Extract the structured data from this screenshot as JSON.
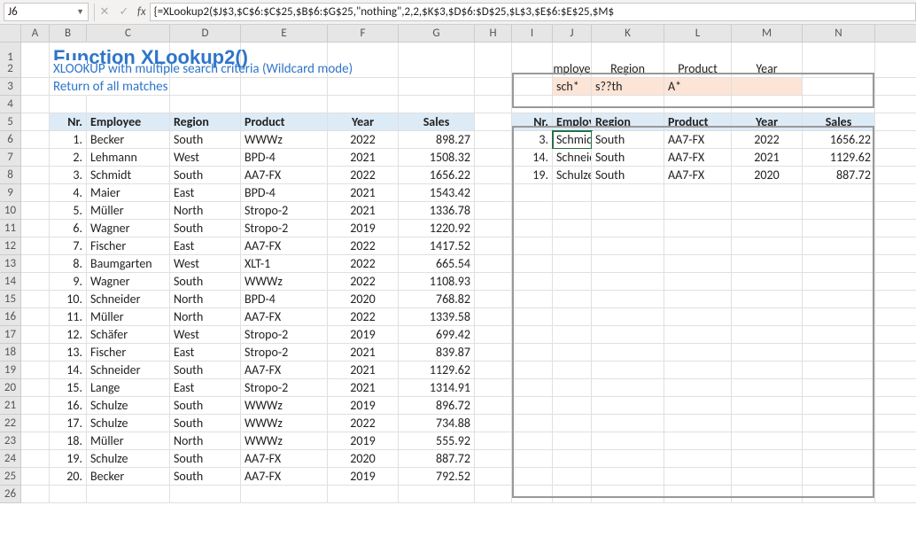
{
  "namebox": "J6",
  "formula": "{=XLookup2($J$3,$C$6:$C$25,$B$6:$G$25,\"nothing\",2,2,$K$3,$D$6:$D$25,$L$3,$E$6:$E$25,$M$",
  "fx_label": "fx",
  "title": "Function XLookup2()",
  "subtitle1": "XLOOKUP with multiple search criteria (Wildcard mode)",
  "subtitle2": "Return of all matches",
  "col_letters": [
    "A",
    "B",
    "C",
    "D",
    "E",
    "F",
    "G",
    "H",
    "I",
    "J",
    "K",
    "L",
    "M",
    "N"
  ],
  "maxRowLabel": 26,
  "criteria_labels": [
    "Employee",
    "Region",
    "Product",
    "Year"
  ],
  "criteria_values": [
    "sch*",
    "s??th",
    "A*",
    ""
  ],
  "table_headers": [
    "Nr.",
    "Employee",
    "Region",
    "Product",
    "Year",
    "Sales"
  ],
  "table_rows": [
    [
      "1.",
      "Becker",
      "South",
      "WWWz",
      "2022",
      "898.27"
    ],
    [
      "2.",
      "Lehmann",
      "West",
      "BPD-4",
      "2021",
      "1508.32"
    ],
    [
      "3.",
      "Schmidt",
      "South",
      "AA7-FX",
      "2022",
      "1656.22"
    ],
    [
      "4.",
      "Maier",
      "East",
      "BPD-4",
      "2021",
      "1543.42"
    ],
    [
      "5.",
      "Müller",
      "North",
      "Stropo-2",
      "2021",
      "1336.78"
    ],
    [
      "6.",
      "Wagner",
      "South",
      "Stropo-2",
      "2019",
      "1220.92"
    ],
    [
      "7.",
      "Fischer",
      "East",
      "AA7-FX",
      "2022",
      "1417.52"
    ],
    [
      "8.",
      "Baumgarten",
      "West",
      "XLT-1",
      "2022",
      "665.54"
    ],
    [
      "9.",
      "Wagner",
      "South",
      "WWWz",
      "2022",
      "1108.93"
    ],
    [
      "10.",
      "Schneider",
      "North",
      "BPD-4",
      "2020",
      "768.82"
    ],
    [
      "11.",
      "Müller",
      "North",
      "AA7-FX",
      "2022",
      "1339.58"
    ],
    [
      "12.",
      "Schäfer",
      "West",
      "Stropo-2",
      "2019",
      "699.42"
    ],
    [
      "13.",
      "Fischer",
      "East",
      "Stropo-2",
      "2021",
      "839.87"
    ],
    [
      "14.",
      "Schneider",
      "South",
      "AA7-FX",
      "2021",
      "1129.62"
    ],
    [
      "15.",
      "Lange",
      "East",
      "Stropo-2",
      "2021",
      "1314.91"
    ],
    [
      "16.",
      "Schulze",
      "South",
      "WWWz",
      "2019",
      "896.72"
    ],
    [
      "17.",
      "Schulze",
      "South",
      "WWWz",
      "2022",
      "734.88"
    ],
    [
      "18.",
      "Müller",
      "North",
      "WWWz",
      "2019",
      "555.92"
    ],
    [
      "19.",
      "Schulze",
      "South",
      "AA7-FX",
      "2020",
      "887.72"
    ],
    [
      "20.",
      "Becker",
      "South",
      "AA7-FX",
      "2019",
      "792.52"
    ]
  ],
  "result_headers": [
    "Nr.",
    "Employee",
    "Region",
    "Product",
    "Year",
    "Sales"
  ],
  "result_rows": [
    [
      "3.",
      "Schmidt",
      "South",
      "AA7-FX",
      "2022",
      "1656.22"
    ],
    [
      "14.",
      "Schneider",
      "South",
      "AA7-FX",
      "2021",
      "1129.62"
    ],
    [
      "19.",
      "Schulze",
      "South",
      "AA7-FX",
      "2020",
      "887.72"
    ]
  ],
  "chart_data": {
    "type": "table",
    "title": "Function XLookup2() – XLOOKUP with multiple search criteria (Wildcard mode), Return of all matches",
    "criteria": {
      "Employee": "sch*",
      "Region": "s??th",
      "Product": "A*",
      "Year": ""
    },
    "source": {
      "columns": [
        "Nr.",
        "Employee",
        "Region",
        "Product",
        "Year",
        "Sales"
      ],
      "rows": [
        [
          1,
          "Becker",
          "South",
          "WWWz",
          2022,
          898.27
        ],
        [
          2,
          "Lehmann",
          "West",
          "BPD-4",
          2021,
          1508.32
        ],
        [
          3,
          "Schmidt",
          "South",
          "AA7-FX",
          2022,
          1656.22
        ],
        [
          4,
          "Maier",
          "East",
          "BPD-4",
          2021,
          1543.42
        ],
        [
          5,
          "Müller",
          "North",
          "Stropo-2",
          2021,
          1336.78
        ],
        [
          6,
          "Wagner",
          "South",
          "Stropo-2",
          2019,
          1220.92
        ],
        [
          7,
          "Fischer",
          "East",
          "AA7-FX",
          2022,
          1417.52
        ],
        [
          8,
          "Baumgarten",
          "West",
          "XLT-1",
          2022,
          665.54
        ],
        [
          9,
          "Wagner",
          "South",
          "WWWz",
          2022,
          1108.93
        ],
        [
          10,
          "Schneider",
          "North",
          "BPD-4",
          2020,
          768.82
        ],
        [
          11,
          "Müller",
          "North",
          "AA7-FX",
          2022,
          1339.58
        ],
        [
          12,
          "Schäfer",
          "West",
          "Stropo-2",
          2019,
          699.42
        ],
        [
          13,
          "Fischer",
          "East",
          "Stropo-2",
          2021,
          839.87
        ],
        [
          14,
          "Schneider",
          "South",
          "AA7-FX",
          2021,
          1129.62
        ],
        [
          15,
          "Lange",
          "East",
          "Stropo-2",
          2021,
          1314.91
        ],
        [
          16,
          "Schulze",
          "South",
          "WWWz",
          2019,
          896.72
        ],
        [
          17,
          "Schulze",
          "South",
          "WWWz",
          2022,
          734.88
        ],
        [
          18,
          "Müller",
          "North",
          "WWWz",
          2019,
          555.92
        ],
        [
          19,
          "Schulze",
          "South",
          "AA7-FX",
          2020,
          887.72
        ],
        [
          20,
          "Becker",
          "South",
          "AA7-FX",
          2019,
          792.52
        ]
      ]
    },
    "result": {
      "columns": [
        "Nr.",
        "Employee",
        "Region",
        "Product",
        "Year",
        "Sales"
      ],
      "rows": [
        [
          3,
          "Schmidt",
          "South",
          "AA7-FX",
          2022,
          1656.22
        ],
        [
          14,
          "Schneider",
          "South",
          "AA7-FX",
          2021,
          1129.62
        ],
        [
          19,
          "Schulze",
          "South",
          "AA7-FX",
          2020,
          887.72
        ]
      ]
    }
  }
}
